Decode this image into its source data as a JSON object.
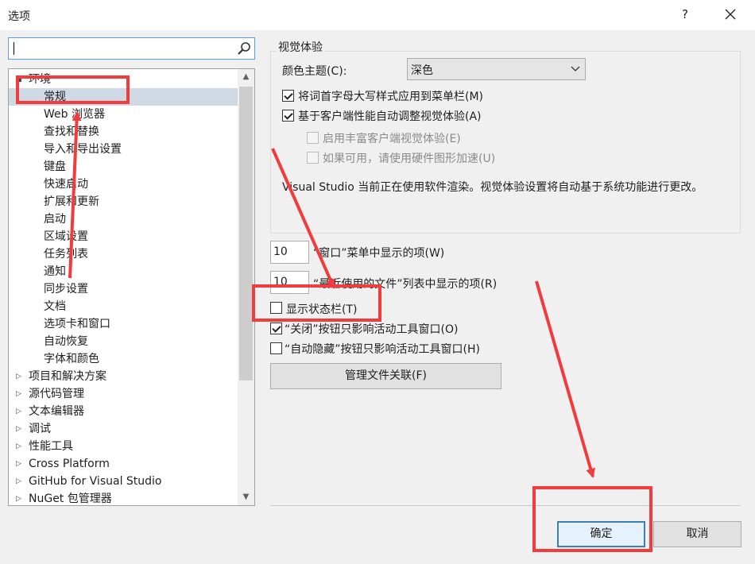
{
  "window": {
    "title": "选项",
    "help_label": "?"
  },
  "search": {
    "placeholder": ""
  },
  "tree": {
    "items": [
      {
        "label": "环境",
        "level": 0,
        "expander": "◢",
        "selected": false
      },
      {
        "label": "常规",
        "level": 1,
        "expander": "",
        "selected": true
      },
      {
        "label": "Web 浏览器",
        "level": 1,
        "expander": "",
        "selected": false
      },
      {
        "label": "查找和替换",
        "level": 1,
        "expander": "",
        "selected": false
      },
      {
        "label": "导入和导出设置",
        "level": 1,
        "expander": "",
        "selected": false
      },
      {
        "label": "键盘",
        "level": 1,
        "expander": "",
        "selected": false
      },
      {
        "label": "快速启动",
        "level": 1,
        "expander": "",
        "selected": false
      },
      {
        "label": "扩展和更新",
        "level": 1,
        "expander": "",
        "selected": false
      },
      {
        "label": "启动",
        "level": 1,
        "expander": "",
        "selected": false
      },
      {
        "label": "区域设置",
        "level": 1,
        "expander": "",
        "selected": false
      },
      {
        "label": "任务列表",
        "level": 1,
        "expander": "",
        "selected": false
      },
      {
        "label": "通知",
        "level": 1,
        "expander": "",
        "selected": false
      },
      {
        "label": "同步设置",
        "level": 1,
        "expander": "",
        "selected": false
      },
      {
        "label": "文档",
        "level": 1,
        "expander": "",
        "selected": false
      },
      {
        "label": "选项卡和窗口",
        "level": 1,
        "expander": "",
        "selected": false
      },
      {
        "label": "自动恢复",
        "level": 1,
        "expander": "",
        "selected": false
      },
      {
        "label": "字体和颜色",
        "level": 1,
        "expander": "",
        "selected": false
      },
      {
        "label": "项目和解决方案",
        "level": 0,
        "expander": "▷",
        "selected": false
      },
      {
        "label": "源代码管理",
        "level": 0,
        "expander": "▷",
        "selected": false
      },
      {
        "label": "文本编辑器",
        "level": 0,
        "expander": "▷",
        "selected": false
      },
      {
        "label": "调试",
        "level": 0,
        "expander": "▷",
        "selected": false
      },
      {
        "label": "性能工具",
        "level": 0,
        "expander": "▷",
        "selected": false
      },
      {
        "label": "Cross Platform",
        "level": 0,
        "expander": "▷",
        "selected": false
      },
      {
        "label": "GitHub for Visual Studio",
        "level": 0,
        "expander": "▷",
        "selected": false
      },
      {
        "label": "NuGet 包管理器",
        "level": 0,
        "expander": "▷",
        "selected": false
      }
    ]
  },
  "visual": {
    "group_title": "视觉体验",
    "theme_label": "颜色主题(C):",
    "theme_value": "深色",
    "cb_title_case": "将词首字母大写样式应用到菜单栏(M)",
    "cb_title_case_checked": true,
    "cb_auto_adjust": "基于客户端性能自动调整视觉体验(A)",
    "cb_auto_adjust_checked": true,
    "cb_rich": "启用丰富客户端视觉体验(E)",
    "cb_rich_checked": false,
    "cb_hw": "如果可用，请使用硬件图形加速(U)",
    "cb_hw_checked": false,
    "info": "Visual Studio 当前正在使用软件渲染。视觉体验设置将自动基于系统功能进行更改。"
  },
  "window_menu": {
    "value": "10",
    "label": "“窗口”菜单中显示的项(W)"
  },
  "recent_files": {
    "value": "10",
    "label": "“最近使用的文件”列表中显示的项(R)"
  },
  "status_bar": {
    "label": "显示状态栏(T)",
    "checked": false
  },
  "close_button": {
    "label": "“关闭”按钮只影响活动工具窗口(O)",
    "checked": true
  },
  "autohide": {
    "label": "“自动隐藏”按钮只影响活动工具窗口(H)",
    "checked": false
  },
  "buttons": {
    "file_assoc": "管理文件关联(F)",
    "ok": "确定",
    "cancel": "取消"
  },
  "colors": {
    "annotation": "#f03c3c",
    "selection": "#cfd9e6",
    "focus": "#569de5"
  }
}
